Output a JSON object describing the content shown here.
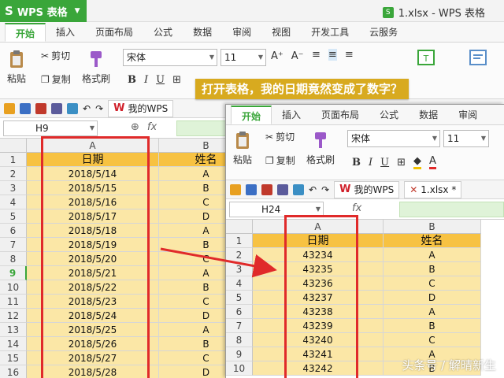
{
  "back": {
    "app_name": "WPS 表格",
    "app_logo": "S",
    "doc_title": "1.xlsx - WPS 表格",
    "tabs": [
      "开始",
      "插入",
      "页面布局",
      "公式",
      "数据",
      "审阅",
      "视图",
      "开发工具",
      "云服务"
    ],
    "ribbon": {
      "paste": "粘贴",
      "cut": "剪切",
      "copy": "复制",
      "format_painter": "格式刷",
      "font_name": "宋体",
      "font_size": "11",
      "grow_font": "A⁺",
      "shrink_font": "A⁻",
      "bold": "B",
      "italic": "I",
      "underline": "U",
      "wrap": "自动换行",
      "merge": "合并居中"
    },
    "qat_doc_tab": "我的WPS",
    "namebox": "H9",
    "fx": "fx",
    "columns": [
      "A",
      "B"
    ],
    "rows": [
      {
        "num": "1",
        "a": "日期",
        "b": "姓名"
      },
      {
        "num": "2",
        "a": "2018/5/14",
        "b": "A"
      },
      {
        "num": "3",
        "a": "2018/5/15",
        "b": "B"
      },
      {
        "num": "4",
        "a": "2018/5/16",
        "b": "C"
      },
      {
        "num": "5",
        "a": "2018/5/17",
        "b": "D"
      },
      {
        "num": "6",
        "a": "2018/5/18",
        "b": "A"
      },
      {
        "num": "7",
        "a": "2018/5/19",
        "b": "B"
      },
      {
        "num": "8",
        "a": "2018/5/20",
        "b": "C"
      },
      {
        "num": "9",
        "a": "2018/5/21",
        "b": "A"
      },
      {
        "num": "10",
        "a": "2018/5/22",
        "b": "B"
      },
      {
        "num": "11",
        "a": "2018/5/23",
        "b": "C"
      },
      {
        "num": "12",
        "a": "2018/5/24",
        "b": "D"
      },
      {
        "num": "13",
        "a": "2018/5/25",
        "b": "A"
      },
      {
        "num": "14",
        "a": "2018/5/26",
        "b": "B"
      },
      {
        "num": "15",
        "a": "2018/5/27",
        "b": "C"
      },
      {
        "num": "16",
        "a": "2018/5/28",
        "b": "D"
      }
    ],
    "selected_row": "9"
  },
  "front": {
    "tabs": [
      "开始",
      "插入",
      "页面布局",
      "公式",
      "数据",
      "审阅"
    ],
    "ribbon": {
      "paste": "粘贴",
      "cut": "剪切",
      "copy": "复制",
      "format_painter": "格式刷",
      "font_name": "宋体",
      "font_size": "11",
      "bold": "B",
      "italic": "I",
      "underline": "U"
    },
    "qat_doc_tabs": [
      "我的WPS",
      "1.xlsx *"
    ],
    "namebox": "H24",
    "fx": "fx",
    "columns": [
      "A",
      "B"
    ],
    "rows": [
      {
        "num": "1",
        "a": "日期",
        "b": "姓名"
      },
      {
        "num": "2",
        "a": "43234",
        "b": "A"
      },
      {
        "num": "3",
        "a": "43235",
        "b": "B"
      },
      {
        "num": "4",
        "a": "43236",
        "b": "C"
      },
      {
        "num": "5",
        "a": "43237",
        "b": "D"
      },
      {
        "num": "6",
        "a": "43238",
        "b": "A"
      },
      {
        "num": "7",
        "a": "43239",
        "b": "B"
      },
      {
        "num": "8",
        "a": "43240",
        "b": "C"
      },
      {
        "num": "9",
        "a": "43241",
        "b": "A"
      },
      {
        "num": "10",
        "a": "43242",
        "b": "B"
      }
    ]
  },
  "callout": "打开表格，我的日期竟然变成了数字？",
  "watermark": "头条号 / 解晴新生",
  "colors": {
    "wps_green": "#3aa63a",
    "header_fill": "#f7c242",
    "data_fill": "#fbe7a6",
    "highlight_red": "#e02a2a",
    "callout_bg": "#d8aa1f"
  }
}
